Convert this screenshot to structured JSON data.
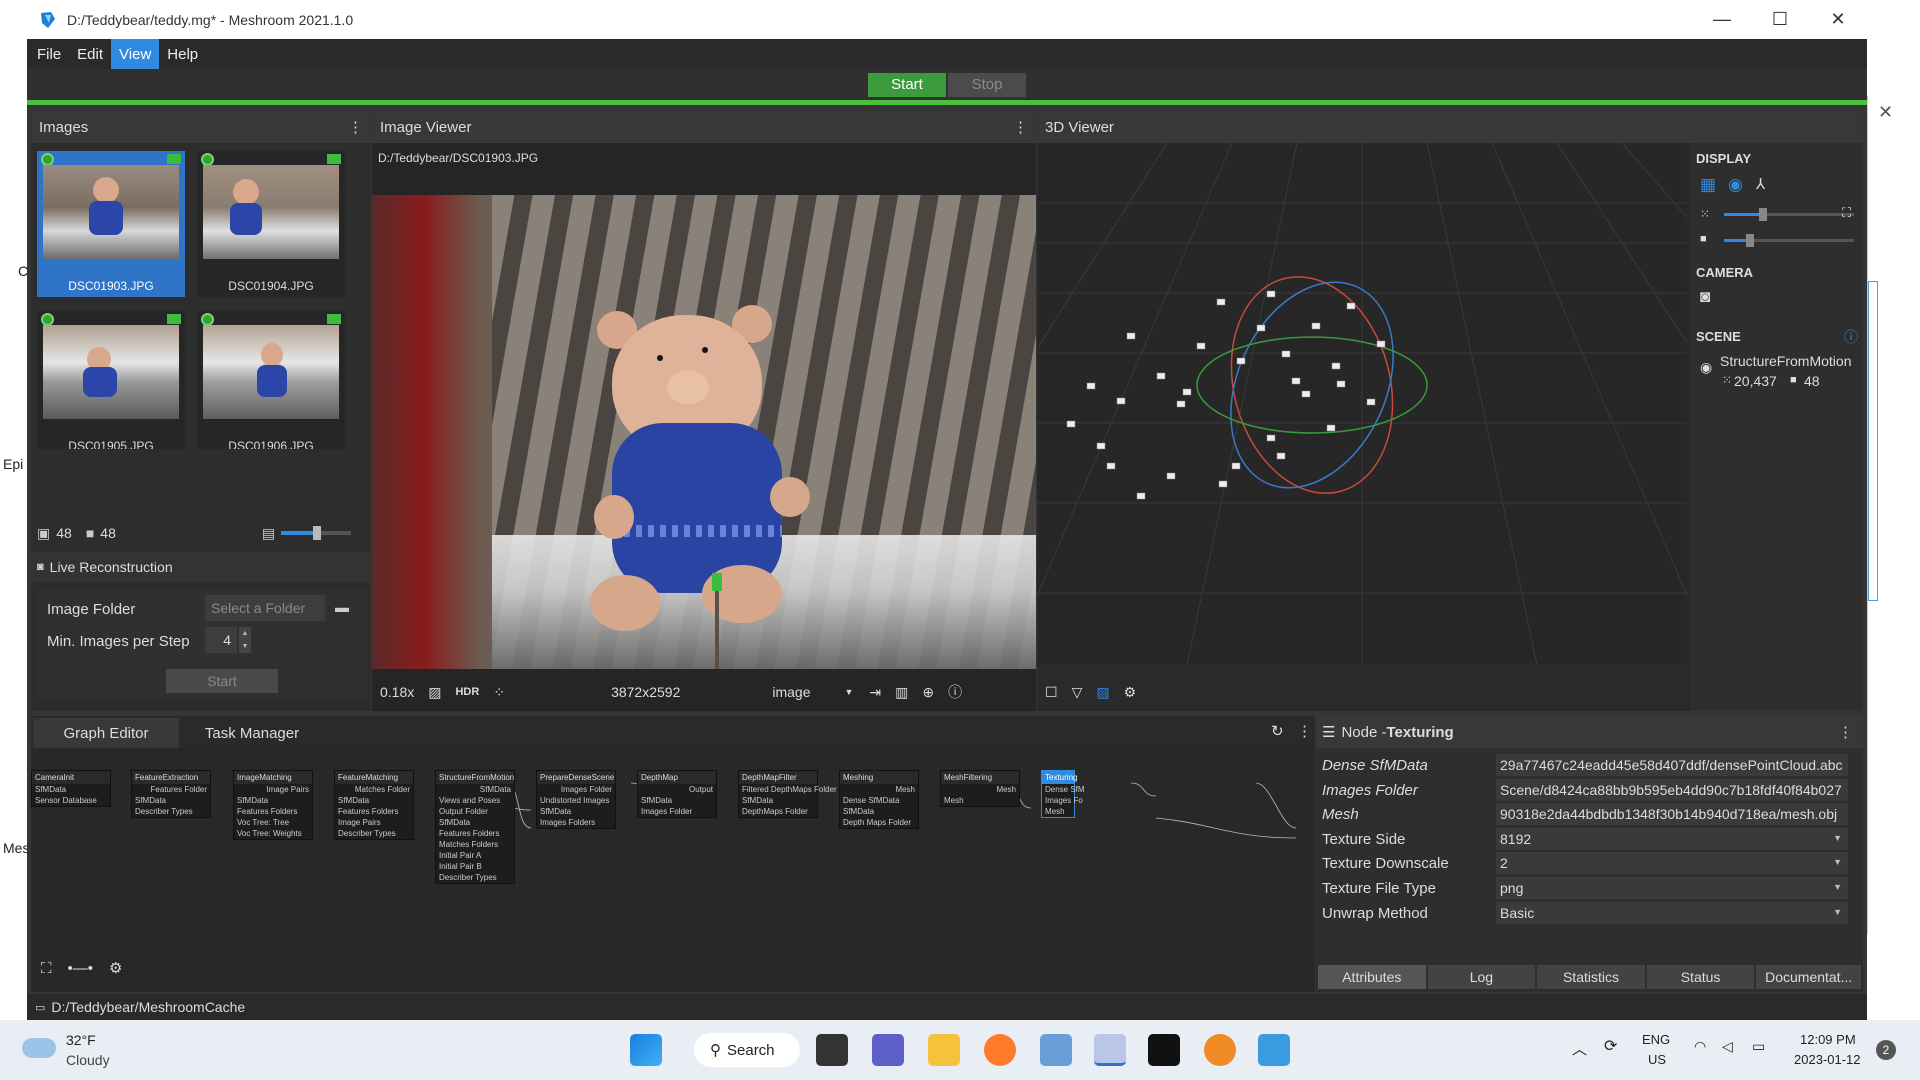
{
  "window": {
    "title": "D:/Teddybear/teddy.mg* - Meshroom 2021.1.0",
    "minimize_glyph": "—",
    "maximize_glyph": "☐",
    "close_glyph": "✕"
  },
  "menu": {
    "items": [
      "File",
      "Edit",
      "View",
      "Help"
    ],
    "active": "View"
  },
  "run": {
    "start": "Start",
    "stop": "Stop"
  },
  "images_panel": {
    "title": "Images",
    "thumbnails": [
      {
        "name": "DSC01903.JPG",
        "selected": true
      },
      {
        "name": "DSC01904.JPG",
        "selected": false
      },
      {
        "name": "DSC01905.JPG",
        "selected": false
      },
      {
        "name": "DSC01906.JPG",
        "selected": false
      }
    ],
    "image_count": "48",
    "camera_count": "48",
    "live_reconstruction": {
      "title": "Live Reconstruction",
      "image_folder_label": "Image Folder",
      "image_folder_placeholder": "Select a Folder",
      "min_images_label": "Min. Images per Step",
      "min_images_value": "4",
      "start": "Start"
    }
  },
  "image_viewer": {
    "title": "Image Viewer",
    "path": "D:/Teddybear/DSC01903.JPG",
    "zoom": "0.18x",
    "hdr": "HDR",
    "resolution": "3872x2592",
    "mode": "image"
  },
  "viewer3d": {
    "title": "3D Viewer",
    "display_label": "DISPLAY",
    "point_size_level": 0.3,
    "camera_scale_level": 0.2,
    "camera_label": "CAMERA",
    "scene_label": "SCENE",
    "scene_item": "StructureFromMotion",
    "points": "20,437",
    "cameras": "48"
  },
  "bottom_tabs": [
    "Graph Editor",
    "Task Manager"
  ],
  "graph_nodes": [
    {
      "title": "CameraInit",
      "rows": [
        "SfMData",
        "Sensor Database"
      ]
    },
    {
      "title": "FeatureExtraction",
      "rows": [
        "Features Folder",
        "SfMData",
        "Describer Types"
      ]
    },
    {
      "title": "ImageMatching",
      "rows": [
        "Image Pairs",
        "SfMData",
        "Features Folders",
        "Voc Tree: Tree",
        "Voc Tree: Weights"
      ]
    },
    {
      "title": "FeatureMatching",
      "rows": [
        "Matches Folder",
        "SfMData",
        "Features Folders",
        "Image Pairs",
        "Describer Types"
      ]
    },
    {
      "title": "StructureFromMotion",
      "rows": [
        "SfMData",
        "Views and Poses",
        "Output Folder",
        "SfMData",
        "Features Folders",
        "Matches Folders",
        "Initial Pair A",
        "Initial Pair B",
        "Describer Types"
      ]
    },
    {
      "title": "PrepareDenseScene",
      "rows": [
        "Images Folder",
        "Undistorted Images",
        "SfMData",
        "Images Folders"
      ]
    },
    {
      "title": "DepthMap",
      "rows": [
        "Output",
        "SfMData",
        "Images Folder"
      ]
    },
    {
      "title": "DepthMapFilter",
      "rows": [
        "Filtered DepthMaps Folder",
        "SfMData",
        "DepthMaps Folder"
      ]
    },
    {
      "title": "Meshing",
      "rows": [
        "Mesh",
        "Dense SfMData",
        "SfMData",
        "Depth Maps Folder"
      ]
    },
    {
      "title": "MeshFiltering",
      "rows": [
        "Mesh",
        "Mesh"
      ]
    },
    {
      "title": "Texturing",
      "rows": [
        "Dense SfM",
        "Images Fo",
        "Mesh"
      ]
    }
  ],
  "node_panel": {
    "prefix": "Node - ",
    "name": "Texturing",
    "attributes": [
      {
        "label": "Dense SfMData",
        "value": "29a77467c24eadd45e58d407ddf/densePointCloud.abc",
        "italic": true
      },
      {
        "label": "Images Folder",
        "value": "Scene/d8424ca88bb9b595eb4dd90c7b18fdf40f84b027",
        "italic": true
      },
      {
        "label": "Mesh",
        "value": "90318e2da44bdbdb1348f30b14b940d718ea/mesh.obj",
        "italic": true
      },
      {
        "label": "Texture Side",
        "value": "8192",
        "italic": false
      },
      {
        "label": "Texture Downscale",
        "value": "2",
        "italic": false
      },
      {
        "label": "Texture File Type",
        "value": "png",
        "italic": false
      },
      {
        "label": "Unwrap Method",
        "value": "Basic",
        "italic": false
      }
    ],
    "tabs": [
      "Attributes",
      "Log",
      "Statistics",
      "Status",
      "Documentat..."
    ]
  },
  "status_path": "D:/Teddybear/MeshroomCache",
  "taskbar": {
    "temp": "32°F",
    "weather": "Cloudy",
    "search": "Search",
    "lang1": "ENG",
    "lang2": "US",
    "time": "12:09 PM",
    "date": "2023-01-12",
    "notif": "2"
  },
  "side_fragments": [
    "C",
    "Epi",
    "Mes"
  ],
  "colors": {
    "accent": "#2f8ae0",
    "green": "#3c9b3c",
    "bg": "#353535"
  }
}
